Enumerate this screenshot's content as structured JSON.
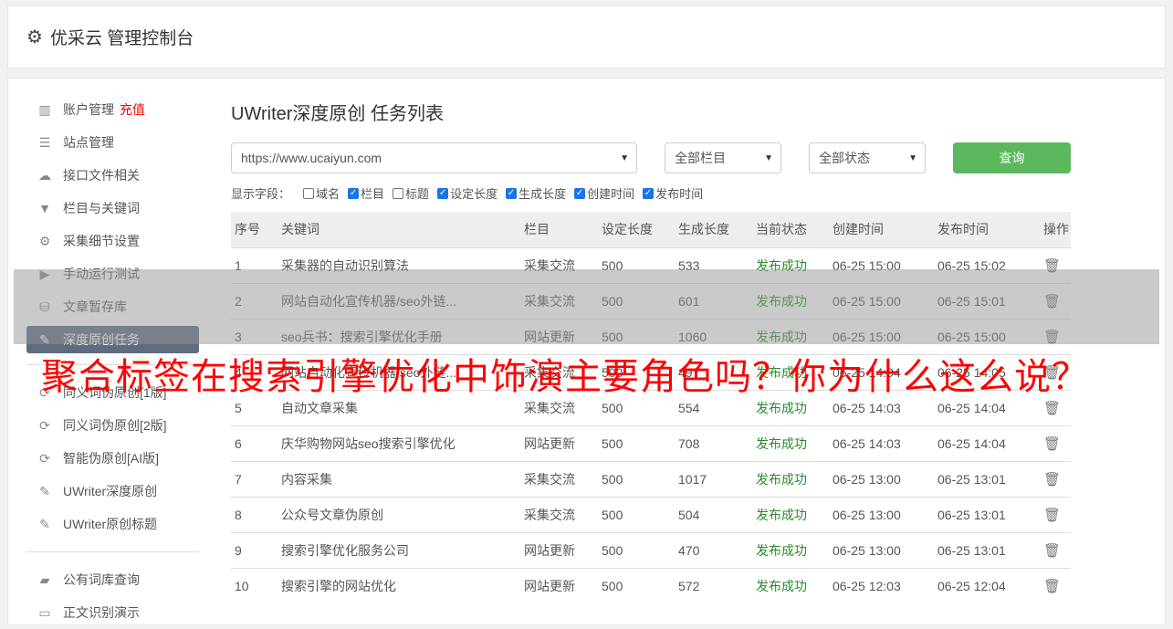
{
  "header": {
    "title": "优采云 管理控制台"
  },
  "sidebar": {
    "items": [
      {
        "label": "账户管理",
        "extra": "充值",
        "icon": "bar-chart-icon"
      },
      {
        "label": "站点管理",
        "icon": "server-icon"
      },
      {
        "label": "接口文件相关",
        "icon": "cloud-upload-icon"
      },
      {
        "label": "栏目与关键词",
        "icon": "filter-icon"
      },
      {
        "label": "采集细节设置",
        "icon": "gears-icon"
      },
      {
        "label": "手动运行测试",
        "icon": "play-icon"
      },
      {
        "label": "文章暂存库",
        "icon": "database-icon"
      },
      {
        "label": "深度原创任务",
        "icon": "edit-icon"
      }
    ],
    "items2": [
      {
        "label": "同义词伪原创[1版]",
        "icon": "refresh-icon"
      },
      {
        "label": "同义词伪原创[2版]",
        "icon": "refresh-icon"
      },
      {
        "label": "智能伪原创[AI版]",
        "icon": "refresh-icon"
      },
      {
        "label": "UWriter深度原创",
        "icon": "edit-icon"
      },
      {
        "label": "UWriter原创标题",
        "icon": "edit-icon"
      }
    ],
    "items3": [
      {
        "label": "公有词库查询",
        "icon": "book-icon"
      },
      {
        "label": "正文识别演示",
        "icon": "monitor-icon"
      }
    ]
  },
  "main": {
    "title": "UWriter深度原创 任务列表",
    "site_select": "https://www.ucaiyun.com",
    "column_select": "全部栏目",
    "status_select": "全部状态",
    "query_label": "查询",
    "fields_label": "显示字段：",
    "fields": [
      {
        "label": "域名",
        "checked": false
      },
      {
        "label": "栏目",
        "checked": true
      },
      {
        "label": "标题",
        "checked": false
      },
      {
        "label": "设定长度",
        "checked": true
      },
      {
        "label": "生成长度",
        "checked": true
      },
      {
        "label": "创建时间",
        "checked": true
      },
      {
        "label": "发布时间",
        "checked": true
      }
    ],
    "columns": [
      "序号",
      "关键词",
      "栏目",
      "设定长度",
      "生成长度",
      "当前状态",
      "创建时间",
      "发布时间",
      "操作"
    ],
    "rows": [
      [
        "1",
        "采集器的自动识别算法",
        "采集交流",
        "500",
        "533",
        "发布成功",
        "06-25 15:00",
        "06-25 15:02"
      ],
      [
        "2",
        "网站自动化宣传机器/seo外链...",
        "采集交流",
        "500",
        "601",
        "发布成功",
        "06-25 15:00",
        "06-25 15:01"
      ],
      [
        "3",
        "seo兵书：搜索引擎优化手册",
        "网站更新",
        "500",
        "1060",
        "发布成功",
        "06-25 15:00",
        "06-25 15:00"
      ],
      [
        "4",
        "网站自动化宣传机器/seo外链...",
        "采集交流",
        "500",
        "497",
        "发布成功",
        "06-25 14:04",
        "06-25 14:05"
      ],
      [
        "5",
        "自动文章采集",
        "采集交流",
        "500",
        "554",
        "发布成功",
        "06-25 14:03",
        "06-25 14:04"
      ],
      [
        "6",
        "庆华购物网站seo搜索引擎优化",
        "网站更新",
        "500",
        "708",
        "发布成功",
        "06-25 14:03",
        "06-25 14:04"
      ],
      [
        "7",
        "内容采集",
        "采集交流",
        "500",
        "1017",
        "发布成功",
        "06-25 13:00",
        "06-25 13:01"
      ],
      [
        "8",
        "公众号文章伪原创",
        "采集交流",
        "500",
        "504",
        "发布成功",
        "06-25 13:00",
        "06-25 13:01"
      ],
      [
        "9",
        "搜索引擎优化服务公司",
        "网站更新",
        "500",
        "470",
        "发布成功",
        "06-25 13:00",
        "06-25 13:01"
      ],
      [
        "10",
        "搜索引擎的网站优化",
        "网站更新",
        "500",
        "572",
        "发布成功",
        "06-25 12:03",
        "06-25 12:04"
      ]
    ]
  },
  "caption": "聚合标签在搜索引擎优化中饰演主要角色吗？你为什么这么说？"
}
